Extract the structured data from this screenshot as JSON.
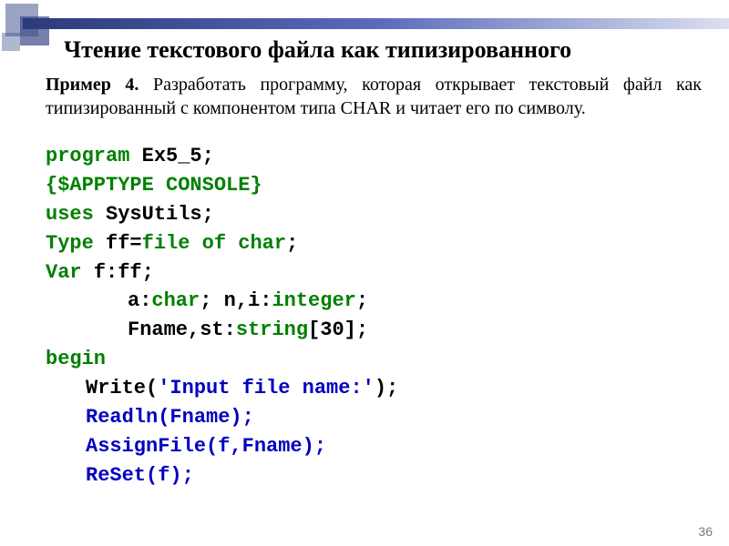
{
  "title": "Чтение текстового файла как типизированного",
  "example": {
    "lead": "Пример 4.",
    "text": " Разработать программу, которая открывает текстовый файл как типизированный с компонентом типа CHAR и читает его по символу."
  },
  "code": {
    "l1a": "program",
    "l1b": " Ex5_5;",
    "l2": "{$APPTYPE CONSOLE}",
    "l3a": "uses",
    "l3b": "  SysUtils;",
    "l4a": "Type",
    "l4b": "  ff=",
    "l4c": "file of char",
    "l4d": ";",
    "l5a": "Var",
    "l5b": "  f:ff;",
    "l6a": "a:",
    "l6b": "char",
    "l6c": ";       n,i:",
    "l6d": "integer",
    "l6e": ";",
    "l7a": "Fname,st:",
    "l7b": "string",
    "l7c": "[30];",
    "l8": "begin",
    "l9a": "Write(",
    "l9b": "'Input file name:'",
    "l9c": ");",
    "l10": "Readln(Fname);",
    "l11": "AssignFile(f,Fname);",
    "l12": "ReSet(f);"
  },
  "page_number": "36"
}
